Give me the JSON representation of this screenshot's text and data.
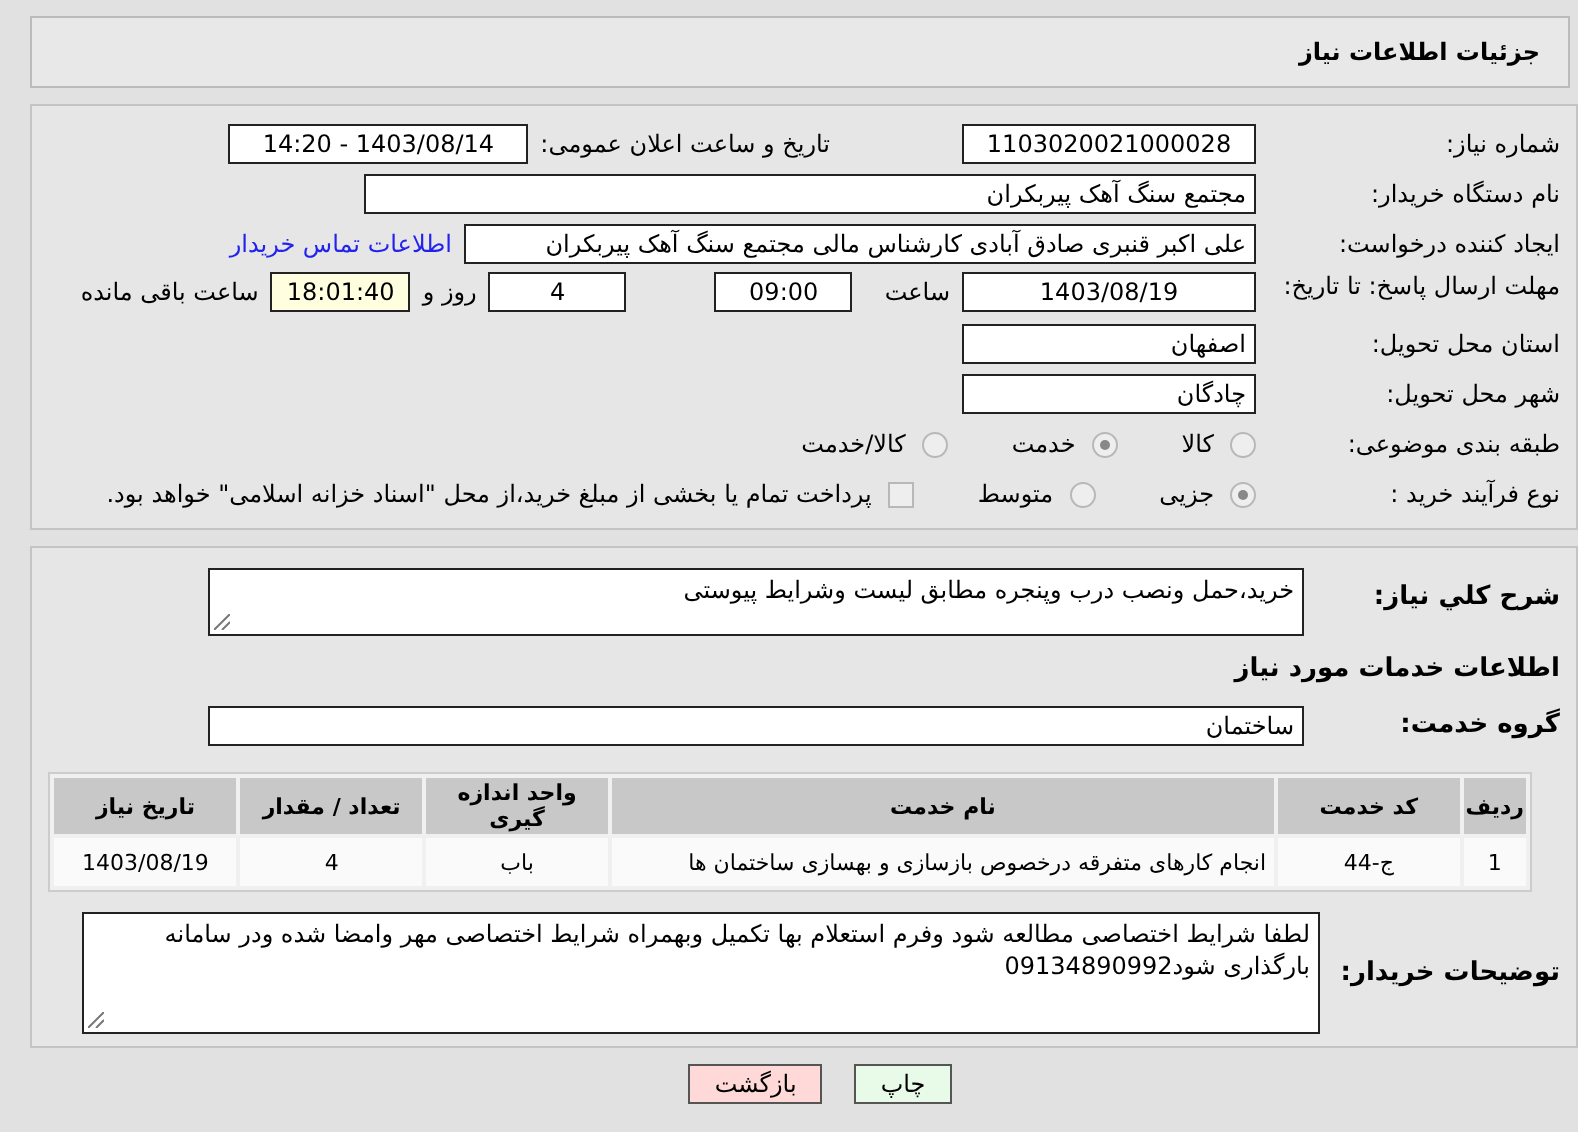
{
  "header": {
    "title": "جزئیات اطلاعات نیاز"
  },
  "need_number": {
    "label": "شماره نیاز:",
    "value": "1103020021000028"
  },
  "announce": {
    "label": "تاریخ و ساعت اعلان عمومی:",
    "value": "1403/08/14 - 14:20"
  },
  "buyer_org": {
    "label": "نام دستگاه خریدار:",
    "value": "مجتمع سنگ آهک پیربکران"
  },
  "creator": {
    "label": "ایجاد کننده درخواست:",
    "value": "علی اکبر قنبری صادق آبادی کارشناس مالی مجتمع سنگ آهک پیربکران",
    "link": "اطلاعات تماس خریدار"
  },
  "deadline": {
    "label": "مهلت ارسال پاسخ: تا تاریخ:",
    "date": "1403/08/19",
    "time_label": "ساعت",
    "time": "09:00",
    "days": "4",
    "days_label": "روز و",
    "remaining": "18:01:40",
    "remaining_label": "ساعت باقی مانده"
  },
  "province": {
    "label": "استان محل تحویل:",
    "value": "اصفهان"
  },
  "city": {
    "label": "شهر محل تحویل:",
    "value": "چادگان"
  },
  "category": {
    "label": "طبقه بندی موضوعی:",
    "options": [
      {
        "label": "کالا",
        "selected": false
      },
      {
        "label": "خدمت",
        "selected": true
      },
      {
        "label": "کالا/خدمت",
        "selected": false
      }
    ]
  },
  "process": {
    "label": "نوع فرآیند خرید :",
    "options": [
      {
        "label": "جزیی",
        "selected": true
      },
      {
        "label": "متوسط",
        "selected": false
      }
    ],
    "treasury": {
      "label": "پرداخت تمام یا بخشی از مبلغ خرید،از محل \"اسناد خزانه اسلامی\" خواهد بود.",
      "checked": false
    }
  },
  "description": {
    "label": "شرح کلي نياز:",
    "value": "خرید،حمل ونصب درب وپنجره مطابق لیست وشرایط پیوستی"
  },
  "services_title": "اطلاعات خدمات مورد نیاز",
  "service_group": {
    "label": "گروه خدمت:",
    "value": "ساختمان"
  },
  "table": {
    "columns": [
      "ردیف",
      "کد خدمت",
      "نام خدمت",
      "واحد اندازه گیری",
      "تعداد / مقدار",
      "تاریخ نیاز"
    ],
    "rows": [
      [
        "1",
        "ج-44",
        "انجام کارهای متفرقه درخصوص بازسازی و بهسازی ساختمان ها",
        "باب",
        "4",
        "1403/08/19"
      ]
    ]
  },
  "buyer_notes": {
    "label": "توضیحات خریدار:",
    "value": "لطفا شرایط اختصاصی مطالعه شود وفرم استعلام بها تکمیل وبهمراه شرایط اختصاصی مهر وامضا شده ودر سامانه بارگذاری شود09134890992"
  },
  "buttons": [
    {
      "label": "چاپ",
      "kind": "print"
    },
    {
      "label": "بازگشت",
      "kind": "back"
    }
  ]
}
